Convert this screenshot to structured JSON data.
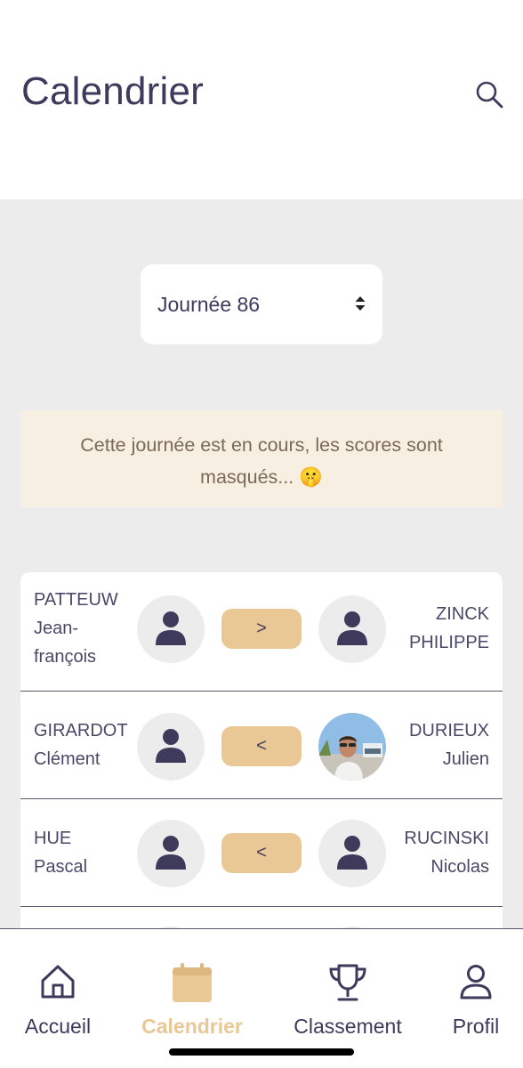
{
  "header": {
    "title": "Calendrier"
  },
  "round_select": {
    "value": "Journée 86"
  },
  "notice": {
    "text": "Cette journée est en cours, les scores sont masqués... 🤫"
  },
  "matches": [
    {
      "home": {
        "last": "PATTEUW",
        "first": "Jean-",
        "first2": "françois"
      },
      "result": ">",
      "away": {
        "last": "ZINCK",
        "first": "PHILIPPE",
        "avatar": "default"
      }
    },
    {
      "home": {
        "last": "GIRARDOT",
        "first": "Clément"
      },
      "result": "<",
      "away": {
        "last": "DURIEUX",
        "first": "Julien",
        "avatar": "photo"
      }
    },
    {
      "home": {
        "last": "HUE",
        "first": "Pascal"
      },
      "result": "<",
      "away": {
        "last": "RUCINSKI",
        "first": "Nicolas",
        "avatar": "default"
      }
    }
  ],
  "tabbar": {
    "items": [
      {
        "label": "Accueil",
        "icon": "home-icon"
      },
      {
        "label": "Calendrier",
        "icon": "calendar-icon",
        "active": true
      },
      {
        "label": "Classement",
        "icon": "trophy-icon"
      },
      {
        "label": "Profil",
        "icon": "user-icon"
      }
    ]
  },
  "colors": {
    "primary": "#3d3a5c",
    "accent": "#e9c896",
    "notice_bg": "#f8efe3",
    "background": "#ececec"
  }
}
